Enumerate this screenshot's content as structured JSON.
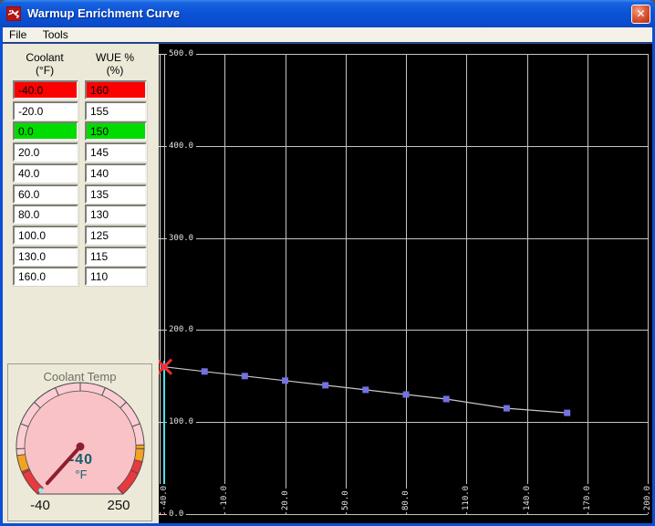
{
  "window": {
    "title": "Warmup Enrichment Curve",
    "close_label": "✕"
  },
  "menu": {
    "items": [
      {
        "label": "File"
      },
      {
        "label": "Tools"
      }
    ]
  },
  "table": {
    "columns": [
      {
        "title": "Coolant",
        "unit": "(°F)"
      },
      {
        "title": "WUE %",
        "unit": "(%)"
      }
    ],
    "rows": [
      {
        "coolant": "-40.0",
        "wue": "160",
        "highlight": "red"
      },
      {
        "coolant": "-20.0",
        "wue": "155",
        "highlight": "none"
      },
      {
        "coolant": "0.0",
        "wue": "150",
        "highlight": "green"
      },
      {
        "coolant": "20.0",
        "wue": "145",
        "highlight": "none"
      },
      {
        "coolant": "40.0",
        "wue": "140",
        "highlight": "none"
      },
      {
        "coolant": "60.0",
        "wue": "135",
        "highlight": "none"
      },
      {
        "coolant": "80.0",
        "wue": "130",
        "highlight": "none"
      },
      {
        "coolant": "100.0",
        "wue": "125",
        "highlight": "none"
      },
      {
        "coolant": "130.0",
        "wue": "115",
        "highlight": "none"
      },
      {
        "coolant": "160.0",
        "wue": "110",
        "highlight": "none"
      }
    ],
    "highlight_colors": {
      "red": "#FF0000",
      "green": "#00DC00",
      "none": "#FFFFFF"
    }
  },
  "gauge": {
    "title": "Coolant Temp",
    "value": "-40",
    "unit": "°F",
    "min": -40,
    "max": 250,
    "min_label": "-40",
    "max_label": "250",
    "current": -40,
    "zones": [
      {
        "from": -40,
        "to": -14,
        "color": "#E8393E"
      },
      {
        "from": -14,
        "to": 2,
        "color": "#F2A322"
      },
      {
        "from": 2,
        "to": 198,
        "color": "#FBCdD2"
      },
      {
        "from": 198,
        "to": 214,
        "color": "#F2A322"
      },
      {
        "from": 214,
        "to": 250,
        "color": "#E8393E"
      }
    ],
    "colors": {
      "face": "#F9C2C7",
      "needle": "#8E1E2E",
      "tip_marker": "#8EE8F2",
      "outline": "#4A4A4A"
    }
  },
  "chart_data": {
    "type": "line",
    "title": "",
    "xlabel": "",
    "ylabel": "",
    "x": [
      -40,
      -20,
      0,
      20,
      40,
      60,
      80,
      100,
      130,
      160
    ],
    "y": [
      160,
      155,
      150,
      145,
      140,
      135,
      130,
      125,
      115,
      110
    ],
    "x_ticks": [
      -40,
      -10,
      20,
      50,
      80,
      110,
      140,
      170,
      200
    ],
    "y_ticks": [
      0,
      100,
      200,
      300,
      400,
      500
    ],
    "xlim": [
      -40,
      200
    ],
    "ylim": [
      0,
      500
    ],
    "grid": true,
    "legend": "none",
    "selected_point_index": 0,
    "cursor_x": -40,
    "colors": {
      "background": "#000000",
      "grid": "#C4C4C4",
      "line": "#C8C8C8",
      "point": "#7272E2",
      "selected_marker": "#FF2A2A",
      "cursor": "#52DEE4",
      "cursor_below_axis": "#F03030",
      "tick_label": "#E4E4E4"
    }
  }
}
